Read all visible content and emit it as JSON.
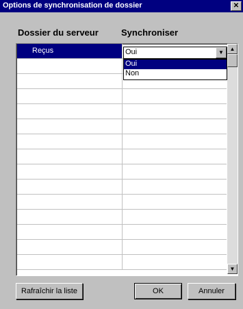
{
  "window": {
    "title": "Options de synchronisation de dossier",
    "close_glyph": "✕"
  },
  "columns": {
    "server": "Dossier du serveur",
    "sync": "Synchroniser"
  },
  "rows": [
    {
      "folder": "Reçus",
      "sync": "Oui",
      "selected": true
    }
  ],
  "combo": {
    "value": "Oui",
    "options": [
      "Oui",
      "Non"
    ],
    "highlighted": "Oui"
  },
  "buttons": {
    "refresh": "Rafraîchir la liste",
    "ok": "OK",
    "cancel": "Annuler"
  },
  "icons": {
    "dropdown_arrow": "chevron-down-icon",
    "scroll_up": "scroll-up-icon",
    "scroll_down": "scroll-down-icon"
  },
  "colors": {
    "titlebar": "#000080",
    "selection": "#000080",
    "face": "#c0c0c0"
  }
}
